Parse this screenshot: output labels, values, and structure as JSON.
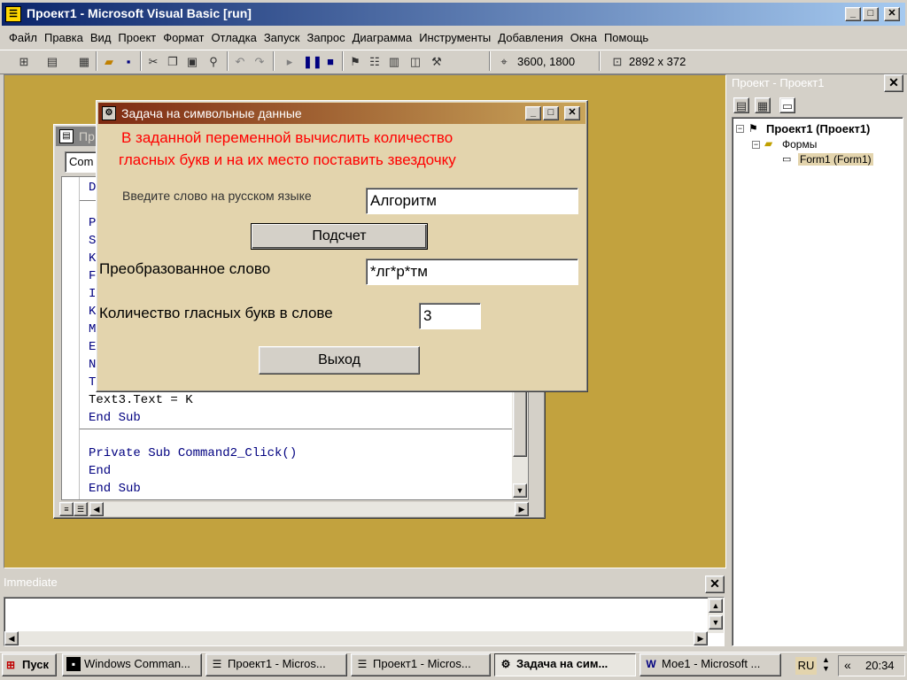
{
  "main_window": {
    "title": "Проект1 - Microsoft Visual Basic [run]",
    "menu": [
      "Файл",
      "Правка",
      "Вид",
      "Проект",
      "Формат",
      "Отладка",
      "Запуск",
      "Запрос",
      "Диаграмма",
      "Инструменты",
      "Добавления",
      "Окна",
      "Помощь"
    ],
    "position_readout": "3600, 1800",
    "size_readout": "2892 x 372"
  },
  "project_explorer": {
    "title": "Проект - Проект1",
    "tree": {
      "root": "Проект1 (Проект1)",
      "folder": "Формы",
      "item": "Form1 (Form1)"
    }
  },
  "code_window": {
    "title": "Пр",
    "combo_value": "Com",
    "line_starts": [
      "D",
      "P",
      "S",
      "K",
      "F",
      "I",
      "K",
      "M",
      "E",
      "N",
      "T"
    ],
    "line_text3": "Text3.Text = K",
    "line_end_sub1": "End Sub",
    "line_private": "Private Sub Command2_Click()",
    "line_end": "End",
    "line_end_sub2": "End Sub"
  },
  "form": {
    "title": "Задача на символьные данные",
    "task_line1": "В заданной переменной вычислить количество",
    "task_line2": "гласных букв и на их место поставить звездочку",
    "input_label": "Введите слово на русском языке",
    "input_value": "Алгоритм",
    "count_button": "Подсчет",
    "result_label": "Преобразованное слово",
    "result_value": "*лг*р*тм",
    "vowels_label": "Количество гласных букв в слове",
    "vowels_value": "3",
    "exit_button": "Выход",
    "accent_color": "#ff0000"
  },
  "immediate": {
    "title": "Immediate"
  },
  "taskbar": {
    "start": "Пуск",
    "tasks": [
      "Windows Comman...",
      "Проект1 - Micros...",
      "Проект1 - Micros...",
      "Задача на сим...",
      "Мое1 - Microsoft ..."
    ],
    "lang": "RU",
    "clock": "20:34",
    "chevron": "«"
  }
}
